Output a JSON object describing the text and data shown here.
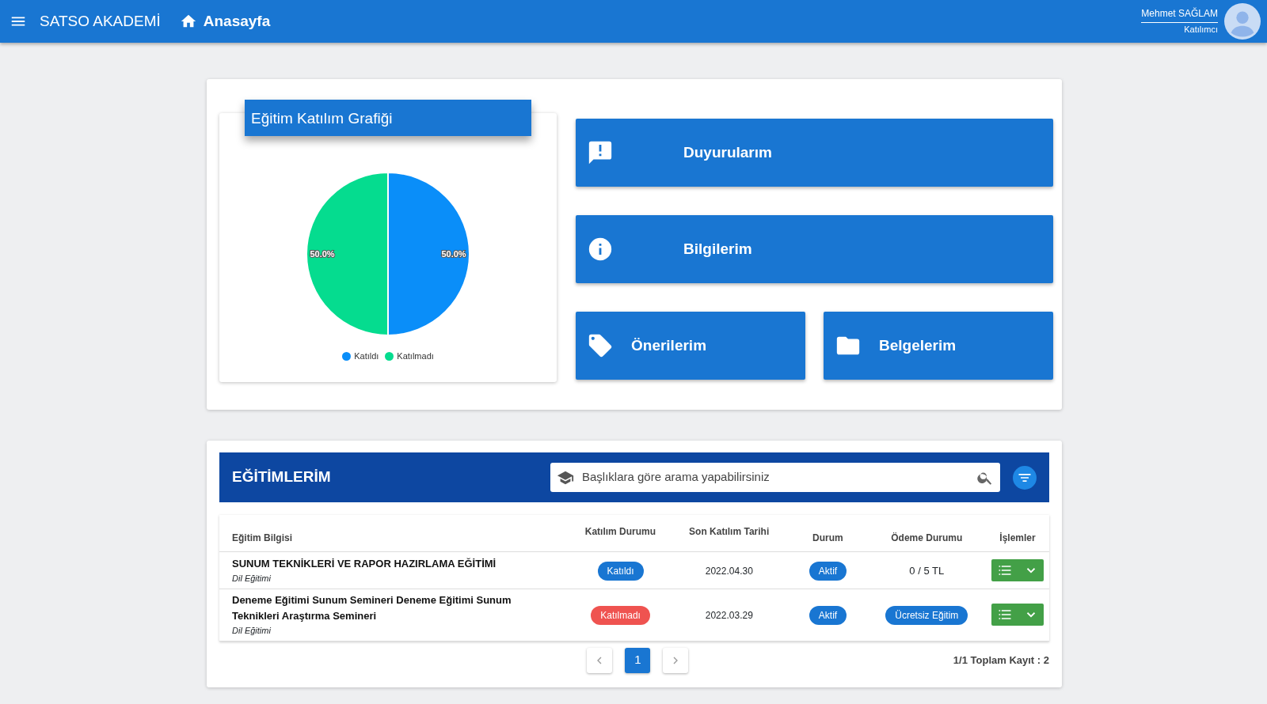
{
  "navbar": {
    "brand": "SATSO AKADEMİ",
    "home": "Anasayfa",
    "user": {
      "name": "Mehmet SAĞLAM",
      "role": "Katılımcı"
    }
  },
  "chart_card": {
    "title": "Eğitim Katılım Grafiği",
    "chart_data": {
      "type": "pie",
      "categories": [
        "Katıldı",
        "Katılmadı"
      ],
      "values": [
        50,
        50
      ],
      "colors": [
        "#0a8ef9",
        "#05dc8f"
      ],
      "value_labels": [
        "50.0%",
        "50.0%"
      ],
      "legend": "bottom"
    }
  },
  "tiles": [
    {
      "label": "Duyurularım",
      "kind": "announcement",
      "wide": true
    },
    {
      "label": "Bilgilerim",
      "kind": "info",
      "wide": true
    },
    {
      "label": "Önerilerim",
      "kind": "tag",
      "wide": false
    },
    {
      "label": "Belgelerim",
      "kind": "folder",
      "wide": false
    }
  ],
  "trainings": {
    "title": "EĞİTİMLERİM",
    "search": {
      "placeholder": "Başlıklara göre arama yapabilirsiniz"
    },
    "columns": [
      "Eğitim Bilgisi",
      "Katılım Durumu",
      "Son Katılım Tarihi",
      "Durum",
      "Ödeme Durumu",
      "İşlemler"
    ],
    "rows": [
      {
        "title": "SUNUM TEKNİKLERİ VE RAPOR HAZIRLAMA EĞİTİMİ",
        "category": "Dil Eğitimi",
        "attendance": {
          "text": "Katıldı",
          "color": "#1976d2"
        },
        "date": "2022.04.30",
        "status": "Aktif",
        "payment": {
          "kind": "text",
          "text": "0 / 5 TL"
        }
      },
      {
        "title": "Deneme Eğitimi Sunum Semineri Deneme Eğitimi Sunum Teknikleri Araştırma Semineri",
        "category": "Dil Eğitimi",
        "attendance": {
          "text": "Katılmadı",
          "color": "#ef5350"
        },
        "date": "2022.03.29",
        "status": "Aktif",
        "payment": {
          "kind": "badge",
          "text": "Ücretsiz Eğitim"
        }
      }
    ],
    "pagination": {
      "pages": [
        {
          "label": "1",
          "selected": true
        }
      ],
      "summary": "1/1 Toplam Kayıt : 2"
    }
  }
}
